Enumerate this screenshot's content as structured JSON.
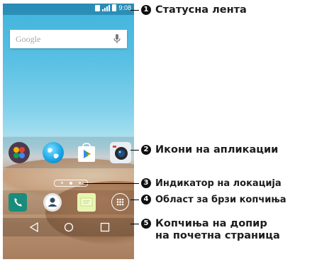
{
  "status_bar": {
    "time": "9:08"
  },
  "search": {
    "placeholder": "Google"
  },
  "apps": [
    "app-folder",
    "browser",
    "play-store",
    "camera"
  ],
  "quick_keys": [
    "phone",
    "contacts",
    "messaging",
    "apps"
  ],
  "nav": [
    "back",
    "home",
    "recent-apps"
  ],
  "callouts": [
    {
      "number": "1",
      "label": "Статусна лента"
    },
    {
      "number": "2",
      "label": "Икони на апликации"
    },
    {
      "number": "3",
      "label": "Индикатор на локација"
    },
    {
      "number": "4",
      "label": "Област за брзи копчиња"
    },
    {
      "number": "5",
      "label_line1": "Копчиња на допир",
      "label_line2": "на почетна страница"
    }
  ]
}
